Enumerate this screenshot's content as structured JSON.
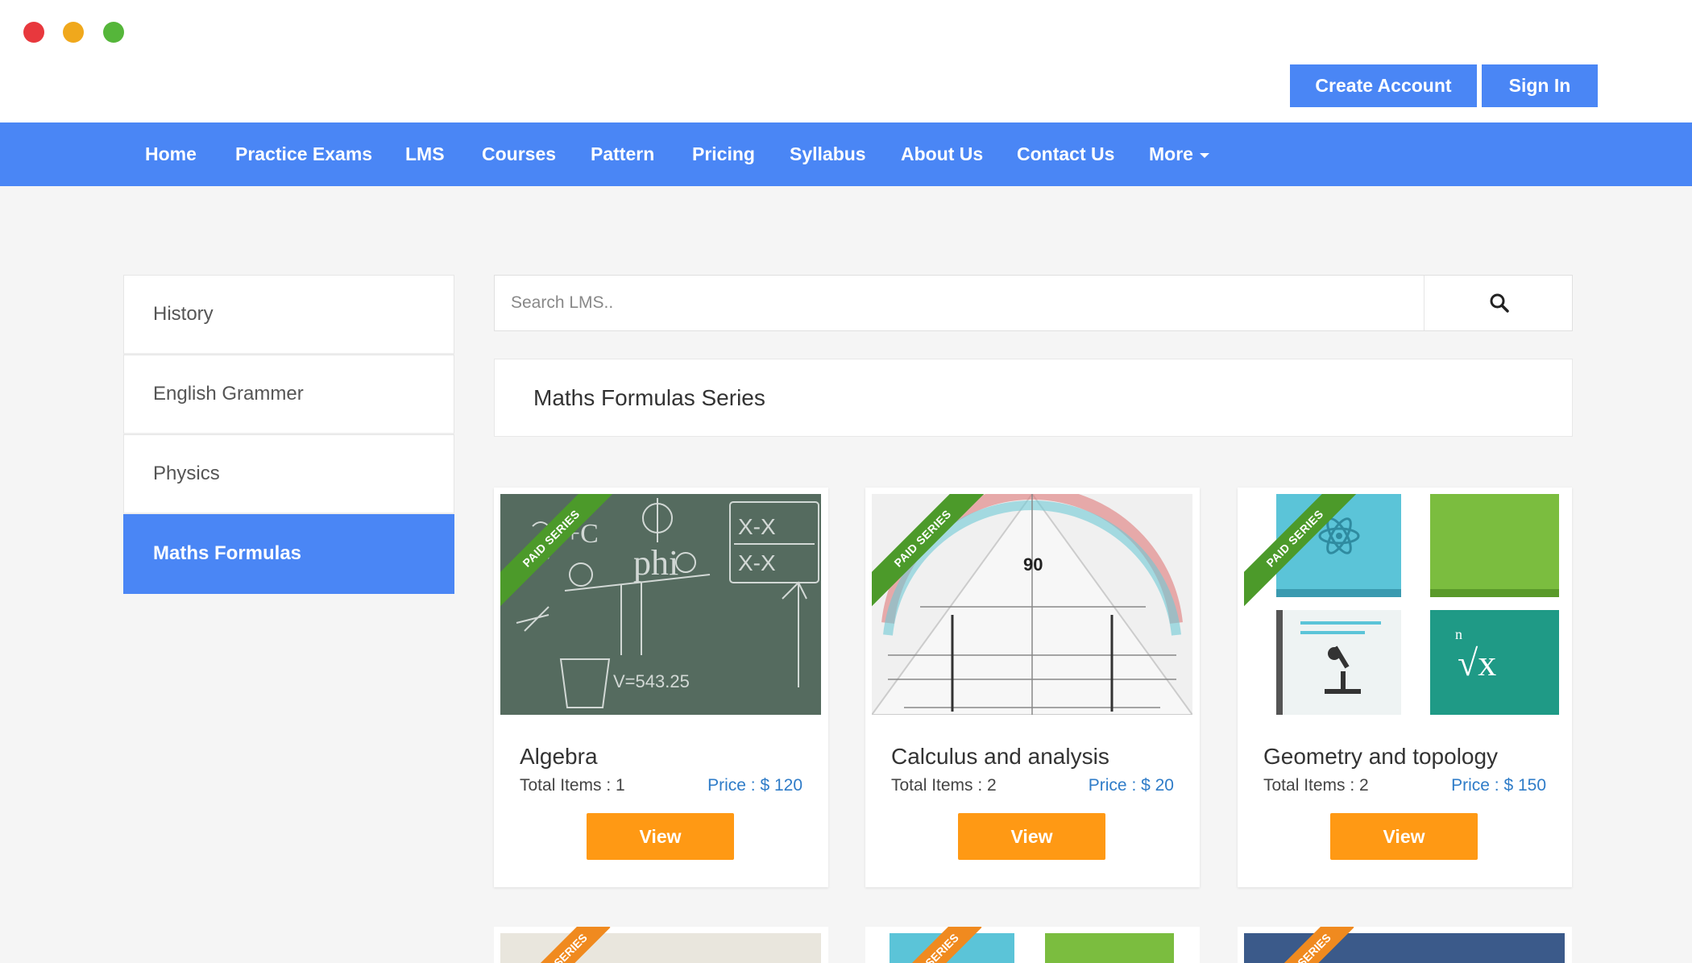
{
  "window": {
    "controls": [
      "close",
      "minimize",
      "maximize"
    ]
  },
  "auth": {
    "create_account": "Create Account",
    "sign_in": "Sign In"
  },
  "nav": {
    "items": [
      "Home",
      "Practice Exams",
      "LMS",
      "Courses",
      "Pattern",
      "Pricing",
      "Syllabus",
      "About Us",
      "Contact Us",
      "More"
    ]
  },
  "sidebar": {
    "items": [
      "History",
      "English Grammer",
      "Physics",
      "Maths Formulas"
    ],
    "active": "Maths Formulas"
  },
  "search": {
    "placeholder": "Search LMS..",
    "icon": "search-icon"
  },
  "series": {
    "title": "Maths Formulas Series"
  },
  "cards": [
    {
      "badge": "PAID SERIES",
      "title": "Algebra",
      "items": "Total Items : 1",
      "price": "Price : $ 120",
      "button": "View",
      "image": "chalkboard"
    },
    {
      "badge": "PAID SERIES",
      "title": "Calculus and analysis",
      "items": "Total Items : 2",
      "price": "Price : $ 20",
      "button": "View",
      "image": "protractor"
    },
    {
      "badge": "PAID SERIES",
      "title": "Geometry and topology",
      "items": "Total Items : 2",
      "price": "Price : $ 150",
      "button": "View",
      "image": "books"
    }
  ],
  "more_cards": [
    {
      "badge": "SERIES"
    },
    {
      "badge": "SERIES"
    },
    {
      "badge": "SERIES"
    }
  ],
  "colors": {
    "brand_blue": "#4a86f5",
    "view_orange": "#ff9914",
    "price_blue": "#2f7cc8",
    "ribbon_green": "#4c9a2a",
    "ribbon_orange": "#f08a1f"
  }
}
